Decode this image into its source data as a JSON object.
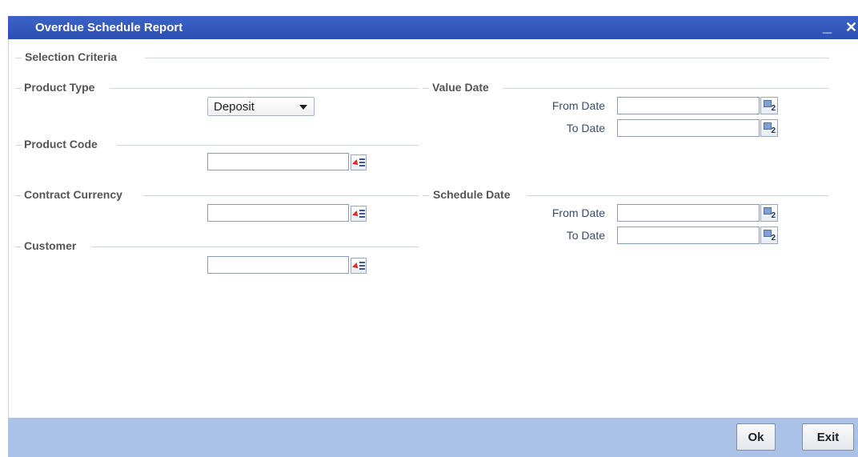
{
  "window": {
    "title": "Overdue Schedule Report",
    "minimize_glyph": "_",
    "close_glyph": "✕"
  },
  "sections": {
    "selection_criteria": "Selection Criteria",
    "product_type": "Product Type",
    "product_code": "Product Code",
    "contract_currency": "Contract Currency",
    "customer": "Customer",
    "value_date": "Value Date",
    "schedule_date": "Schedule Date"
  },
  "fields": {
    "product_type_selected": "Deposit",
    "product_code_value": "",
    "contract_currency_value": "",
    "customer_value": "",
    "from_date_label": "From Date",
    "to_date_label": "To Date",
    "value_from_date": "",
    "value_to_date": "",
    "schedule_from_date": "",
    "schedule_to_date": ""
  },
  "icons": {
    "lov": "list-of-values-icon",
    "calendar": "calendar-icon",
    "calendar_number": "2"
  },
  "buttons": {
    "ok": "Ok",
    "exit": "Exit"
  }
}
